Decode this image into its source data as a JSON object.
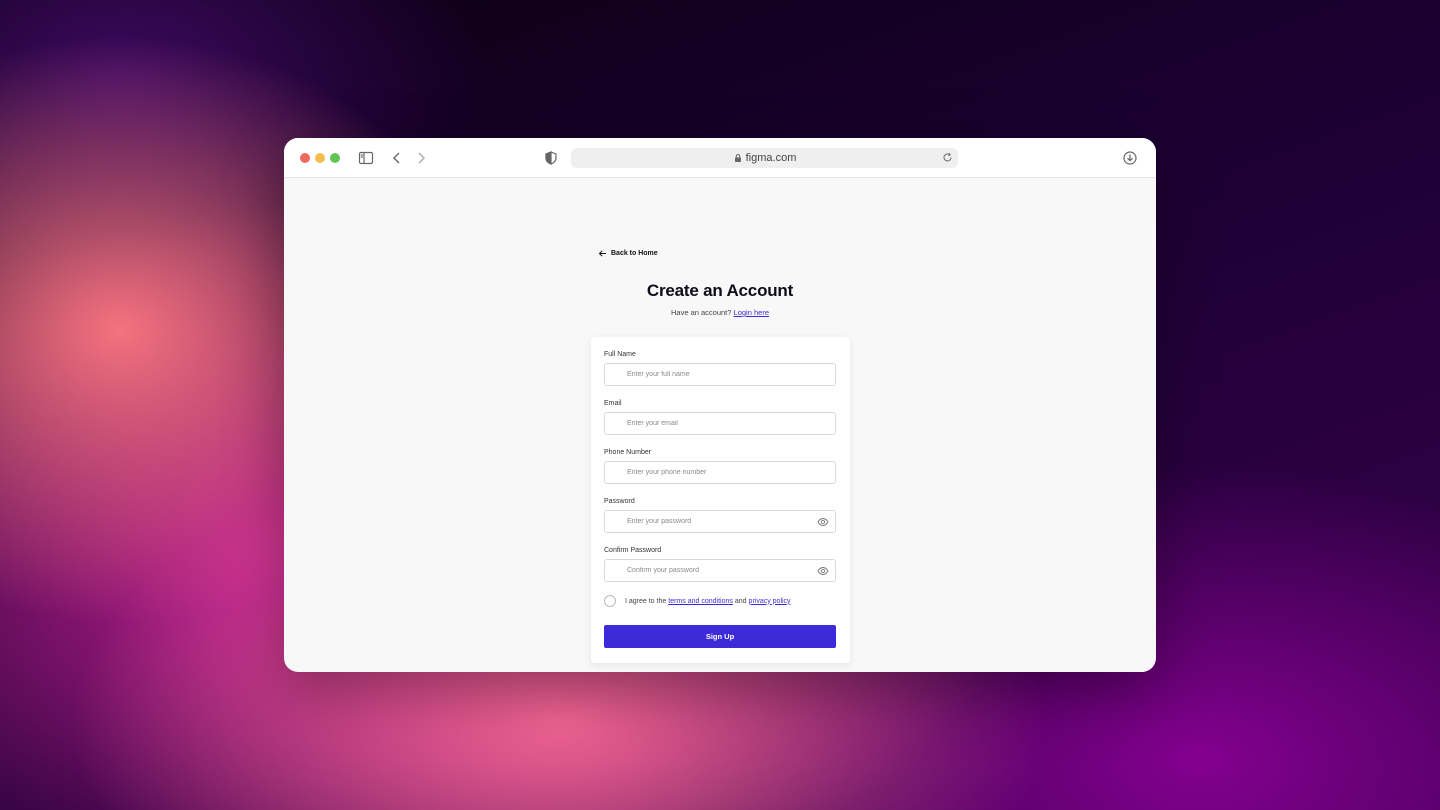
{
  "browser": {
    "url": "figma.com"
  },
  "page": {
    "back_link": "Back to Home",
    "title": "Create an Account",
    "subtitle_prefix": "Have an account?",
    "login_link": "Login here"
  },
  "form": {
    "full_name": {
      "label": "Full Name",
      "placeholder": "Enter your full name"
    },
    "email": {
      "label": "Email",
      "placeholder": "Enter your email"
    },
    "phone": {
      "label": "Phone Number",
      "placeholder": "Enter your phone number"
    },
    "password": {
      "label": "Password",
      "placeholder": "Enter your password"
    },
    "confirm_password": {
      "label": "Confirm Password",
      "placeholder": "Confirm your password"
    },
    "agree_prefix": "I agree to the",
    "terms_link": "terms and conditions",
    "agree_and": "and",
    "privacy_link": "privacy policy",
    "submit_label": "Sign Up"
  },
  "colors": {
    "accent": "#3c2bd6",
    "link": "#3b2bd6"
  },
  "icons": {
    "back": "arrow-left-icon",
    "sidebar": "sidebar-icon",
    "shield": "shield-icon",
    "lock": "lock-icon",
    "reload": "reload-icon",
    "download": "download-icon",
    "eye": "eye-icon"
  }
}
